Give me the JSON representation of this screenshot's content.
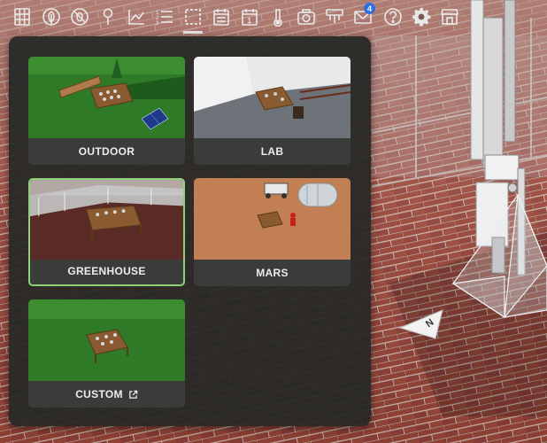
{
  "toolbar": {
    "icons": [
      "grid-icon",
      "leaf-icon",
      "no-pests-icon",
      "location-pin-icon",
      "chart-icon",
      "numbered-list-icon",
      "selection-icon",
      "calendar-icon",
      "calendar-day-icon",
      "thermometer-icon",
      "camera-icon",
      "sensor-icon",
      "messages-icon",
      "help-icon",
      "gear-icon",
      "store-icon"
    ],
    "active_icon": "selection-icon",
    "messages_badge": "4"
  },
  "environments": {
    "items": [
      {
        "id": "outdoor",
        "label": "OUTDOOR",
        "selected": false,
        "external": false
      },
      {
        "id": "lab",
        "label": "LAB",
        "selected": false,
        "external": false
      },
      {
        "id": "greenhouse",
        "label": "GREENHOUSE",
        "selected": true,
        "external": false
      },
      {
        "id": "mars",
        "label": "MARS",
        "selected": false,
        "external": false
      },
      {
        "id": "custom",
        "label": "CUSTOM",
        "selected": false,
        "external": true
      }
    ]
  },
  "compass": {
    "label": "N"
  },
  "colors": {
    "accent_selected": "#8fd07a",
    "panel_bg": "#262826",
    "badge": "#2f6fe0",
    "icon": "#e8e8e8"
  }
}
